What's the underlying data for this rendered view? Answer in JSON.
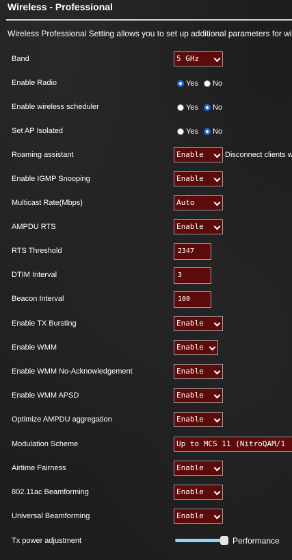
{
  "page": {
    "title": "Wireless - Professional",
    "description": "Wireless Professional Setting allows you to set up additional parameters for wire"
  },
  "radio_labels": {
    "yes": "Yes",
    "no": "No"
  },
  "rows": {
    "band": {
      "label": "Band",
      "value": "5 GHz"
    },
    "enable_radio": {
      "label": "Enable Radio",
      "selected": "Yes"
    },
    "wireless_sched": {
      "label": "Enable wireless scheduler",
      "selected": "No"
    },
    "ap_isolated": {
      "label": "Set AP Isolated",
      "selected": "No"
    },
    "roaming": {
      "label": "Roaming assistant",
      "value": "Enable",
      "note": "Disconnect clients w"
    },
    "igmp": {
      "label": "Enable IGMP Snooping",
      "value": "Enable"
    },
    "multicast": {
      "label": "Multicast Rate(Mbps)",
      "value": "Auto"
    },
    "ampdu_rts": {
      "label": "AMPDU RTS",
      "value": "Enable"
    },
    "rts_threshold": {
      "label": "RTS Threshold",
      "value": "2347"
    },
    "dtim": {
      "label": "DTIM Interval",
      "value": "3"
    },
    "beacon": {
      "label": "Beacon Interval",
      "value": "100"
    },
    "tx_bursting": {
      "label": "Enable TX Bursting",
      "value": "Enable"
    },
    "wmm": {
      "label": "Enable WMM",
      "value": "Enable"
    },
    "wmm_noack": {
      "label": "Enable WMM No-Acknowledgement",
      "value": "Enable"
    },
    "wmm_apsd": {
      "label": "Enable WMM APSD",
      "value": "Enable"
    },
    "ampdu_agg": {
      "label": "Optimize AMPDU aggregation",
      "value": "Enable"
    },
    "modulation": {
      "label": "Modulation Scheme",
      "value": "Up to MCS 11 (NitroQAM/1"
    },
    "airtime": {
      "label": "Airtime Fairness",
      "value": "Enable"
    },
    "beamforming_ac": {
      "label": "802.11ac Beamforming",
      "value": "Enable"
    },
    "beamforming_uni": {
      "label": "Universal Beamforming",
      "value": "Enable"
    },
    "tx_power": {
      "label": "Tx power adjustment",
      "value_text": "Performance",
      "level": 1.0
    }
  },
  "colors": {
    "select_bg": "#5d0a0a",
    "radio_accent": "#1b6fd6",
    "slider_track": "#8fd7ff"
  }
}
